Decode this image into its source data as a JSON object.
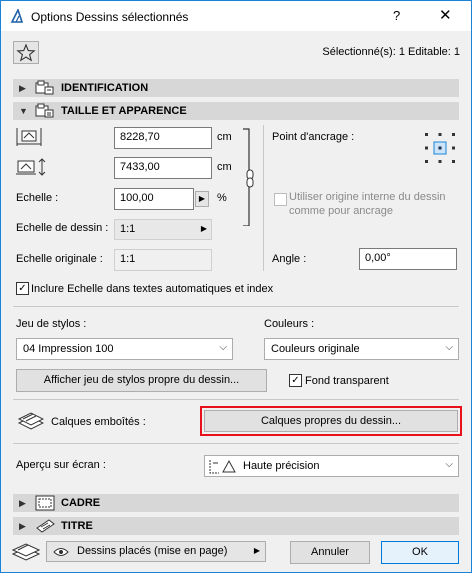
{
  "window": {
    "title": "Options Dessins sélectionnés",
    "help": "?",
    "close": "✕"
  },
  "header": {
    "selection_info": "Sélectionné(s): 1 Editable: 1"
  },
  "sections": {
    "identification": "IDENTIFICATION",
    "taille": "TAILLE ET APPARENCE",
    "cadre": "CADRE",
    "titre": "TITRE"
  },
  "size": {
    "width_value": "8228,70",
    "height_value": "7433,00",
    "unit_width": "cm",
    "unit_height": "cm",
    "scale_label": "Echelle :",
    "scale_value": "100,00",
    "scale_unit": "%",
    "drawing_scale_label": "Echelle de dessin :",
    "drawing_scale_value": "1:1",
    "original_scale_label": "Echelle originale :",
    "original_scale_value": "1:1",
    "anchor_label": "Point d'ancrage :",
    "use_origin_label": "Utiliser origine interne du dessin comme pour ancrage",
    "angle_label": "Angle :",
    "angle_value": "0,00°",
    "include_scale_label": "Inclure Echelle dans textes automatiques et index",
    "include_scale_checked": true
  },
  "pens": {
    "label": "Jeu de stylos :",
    "value": "04 Impression 100",
    "colors_label": "Couleurs :",
    "colors_value": "Couleurs originale",
    "show_pens_button": "Afficher jeu de stylos propre du dessin...",
    "transparent_label": "Fond transparent",
    "transparent_checked": true
  },
  "layers": {
    "label": "Calques emboîtés :",
    "button": "Calques propres du dessin..."
  },
  "preview": {
    "label": "Aperçu sur écran :",
    "value": "Haute précision"
  },
  "footer": {
    "placed_label": "Dessins placés (mise en page)",
    "cancel": "Annuler",
    "ok": "OK"
  },
  "colors": {
    "highlight": "#e8101a",
    "accent": "#1883d7",
    "section_bg": "#d7d7d7"
  }
}
